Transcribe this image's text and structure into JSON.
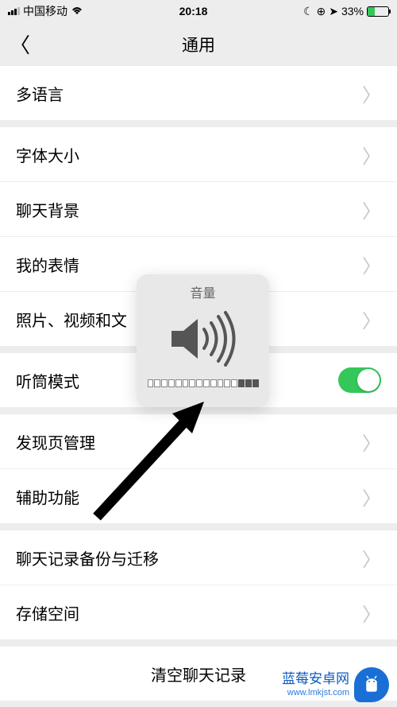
{
  "status": {
    "carrier": "中国移动",
    "time": "20:18",
    "battery_pct": "33%"
  },
  "nav": {
    "title": "通用"
  },
  "items": {
    "language": "多语言",
    "font_size": "字体大小",
    "chat_bg": "聊天背景",
    "stickers": "我的表情",
    "photos": "照片、视频和文",
    "receiver_mode": "听筒模式",
    "discover": "发现页管理",
    "accessibility": "辅助功能",
    "backup": "聊天记录备份与迁移",
    "storage": "存储空间",
    "clear": "清空聊天记录"
  },
  "volume": {
    "title": "音量"
  },
  "watermark": {
    "name": "蓝莓安卓网",
    "url": "www.lmkjst.com"
  }
}
